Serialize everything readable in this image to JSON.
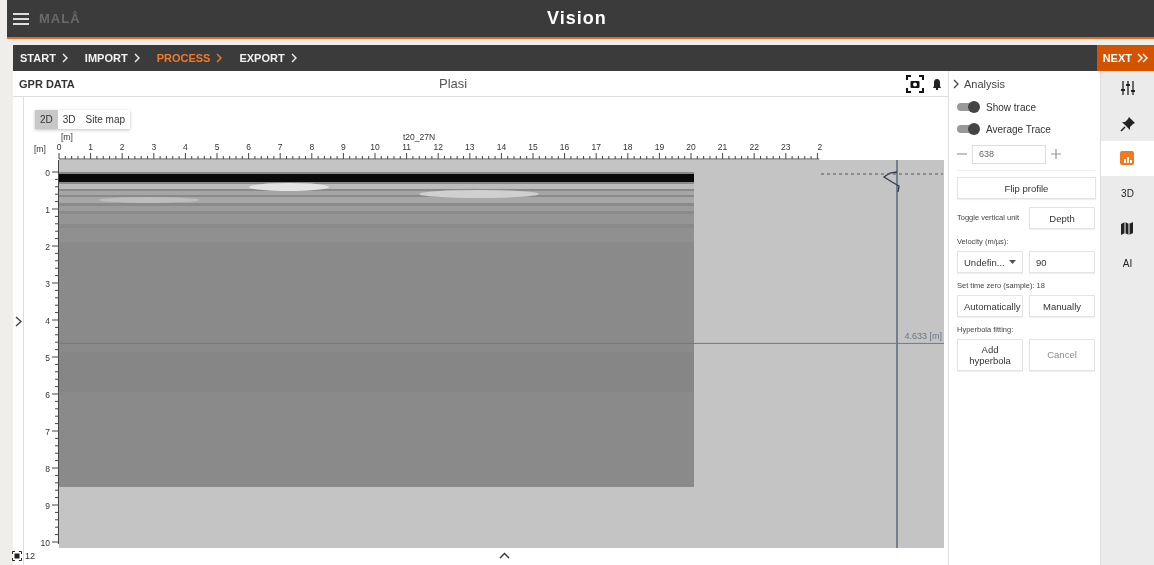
{
  "app": {
    "logo": "MALÅ",
    "title": "Vision"
  },
  "breadcrumbs": [
    {
      "label": "START",
      "selected": false
    },
    {
      "label": "IMPORT",
      "selected": false
    },
    {
      "label": "PROCESS",
      "selected": true
    },
    {
      "label": "EXPORT",
      "selected": false
    }
  ],
  "next_button": "NEXT",
  "panel": {
    "title": "GPR DATA",
    "profile_name": "Plasi",
    "view_tabs": [
      {
        "label": "2D",
        "selected": true
      },
      {
        "label": "3D",
        "selected": false
      },
      {
        "label": "Site map",
        "selected": false
      }
    ]
  },
  "plot": {
    "x_unit": "[m]",
    "y_unit": "[m]",
    "profile_label": "t20_27N",
    "x_ticks": [
      "0",
      "1",
      "2",
      "3",
      "4",
      "5",
      "6",
      "7",
      "8",
      "9",
      "10",
      "11",
      "12",
      "13",
      "14",
      "15",
      "16",
      "17",
      "18",
      "19",
      "20",
      "21",
      "22",
      "23",
      "2"
    ],
    "y_ticks": [
      "0",
      "1",
      "2",
      "3",
      "4",
      "5",
      "6",
      "7",
      "8",
      "9",
      "10"
    ],
    "depth_marker": "4.633 [m]"
  },
  "footer": {
    "zoom_count": "12"
  },
  "analysis": {
    "title": "Analysis",
    "toggles": [
      {
        "label": "Show trace",
        "on": true
      },
      {
        "label": "Average Trace",
        "on": true
      }
    ],
    "trace_number": "638",
    "flip_button": "Flip profile",
    "vertical_unit": {
      "label": "Toggle vertical unit",
      "button": "Depth"
    },
    "velocity": {
      "label": "Velocity (m/µs):",
      "select": "Undefin...",
      "value": "90"
    },
    "time_zero": {
      "label": "Set time zero (sample): 18",
      "buttons": [
        "Automatically",
        "Manually"
      ]
    },
    "hyperbola": {
      "label": "Hyperbola fitting:",
      "buttons": [
        {
          "label": "Add hyperbola",
          "disabled": false
        },
        {
          "label": "Cancel",
          "disabled": true
        }
      ]
    }
  },
  "rail": [
    {
      "kind": "sliders",
      "selected": false
    },
    {
      "kind": "pin",
      "selected": false
    },
    {
      "kind": "chart",
      "selected": true
    },
    {
      "kind": "text",
      "label": "3D",
      "selected": false
    },
    {
      "kind": "map",
      "selected": false
    },
    {
      "kind": "text",
      "label": "AI",
      "selected": false
    }
  ]
}
